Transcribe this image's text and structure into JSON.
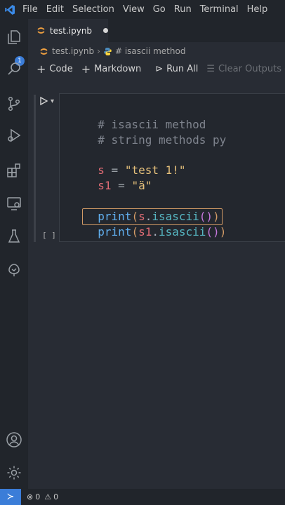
{
  "menubar": {
    "items": [
      "File",
      "Edit",
      "Selection",
      "View",
      "Go",
      "Run",
      "Terminal",
      "Help"
    ]
  },
  "activitybar": {
    "icons": [
      "explorer-icon",
      "search-icon",
      "source-control-icon",
      "run-debug-icon",
      "extensions-icon",
      "remote-explorer-icon",
      "testing-icon",
      "docker-icon",
      "accounts-icon",
      "manage-icon"
    ],
    "explorer_badge": "1"
  },
  "tab": {
    "label": "test.ipynb",
    "modified": true
  },
  "breadcrumb": {
    "file": "test.ipynb",
    "symbol": "# isascii method"
  },
  "notebook_toolbar": {
    "add_code": "Code",
    "add_markdown": "Markdown",
    "run_all": "Run All",
    "clear_outputs": "Clear Outputs of A"
  },
  "cell": {
    "exec_count": "[ ]",
    "lines": [
      "# isascii method",
      "# string methods py",
      "",
      "s = \"test 1!\"",
      "s1 = \"ä\"",
      "",
      "print(s.isascii())",
      "print(s1.isascii())"
    ],
    "tokens": {
      "l1": "# isascii method",
      "l2": "# string methods py",
      "l4_var": "s",
      "l4_op": " = ",
      "l4_str": "\"test 1!\"",
      "l5_var": "s1",
      "l5_op": " = ",
      "l5_str": "\"ä\"",
      "print": "print",
      "open": "(",
      "close": ")",
      "dot": ".",
      "method": "isascii",
      "call": "()",
      "var_s": "s",
      "var_s1": "s1"
    }
  },
  "statusbar": {
    "errors": "0",
    "warnings": "0"
  },
  "colors": {
    "accent": "#3b7dd8",
    "background": "#282c34"
  }
}
